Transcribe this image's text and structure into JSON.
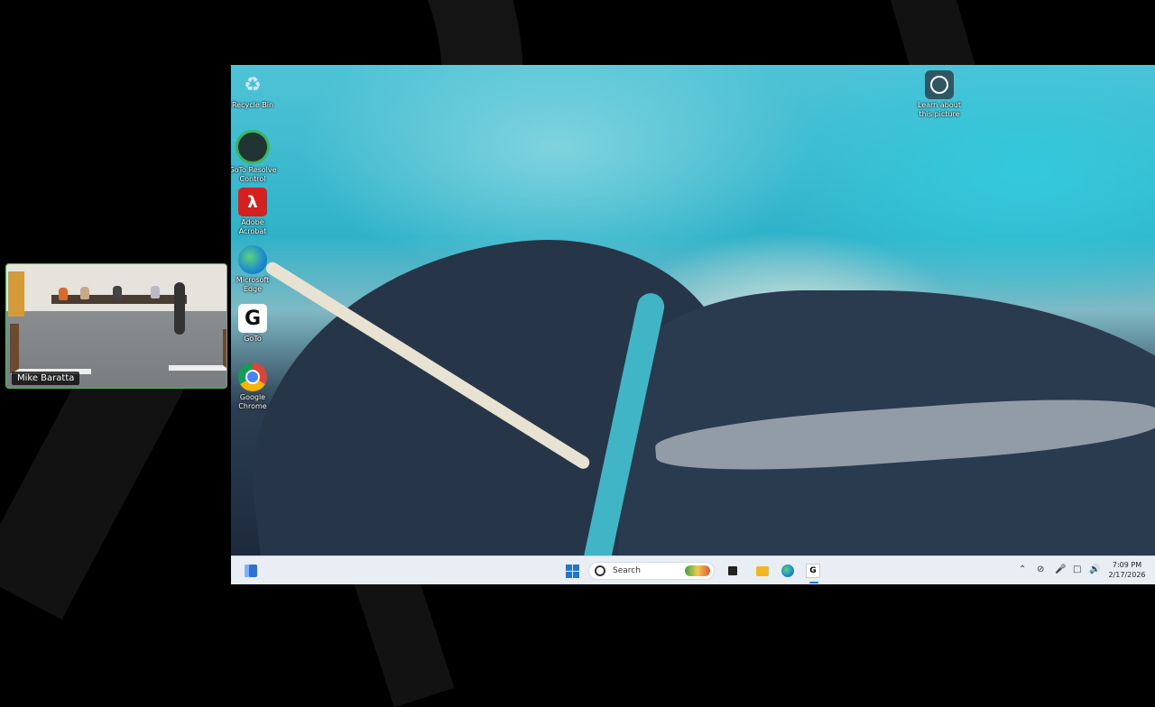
{
  "desktop": {
    "icons": [
      {
        "name": "recycle-bin",
        "label": "Recycle Bin"
      },
      {
        "name": "goto-control",
        "label": "GoTo Resolve Control"
      },
      {
        "name": "adobe-acrobat",
        "label": "Adobe Acrobat"
      },
      {
        "name": "microsoft-edge",
        "label": "Microsoft Edge"
      },
      {
        "name": "goto",
        "label": "GoTo"
      },
      {
        "name": "google-chrome",
        "label": "Google Chrome"
      }
    ],
    "learn_about_picture": "Learn about this picture"
  },
  "taskbar": {
    "search_label": "Search",
    "clock_time": "7:09 PM",
    "clock_date": "2/17/2026"
  },
  "webcam": {
    "participant_name": "Mike Baratta"
  },
  "colors": {
    "background": "#000000",
    "taskbar": "#e8eef3",
    "accent": "#1a78d6",
    "webcam_border": "#4fb86b"
  }
}
